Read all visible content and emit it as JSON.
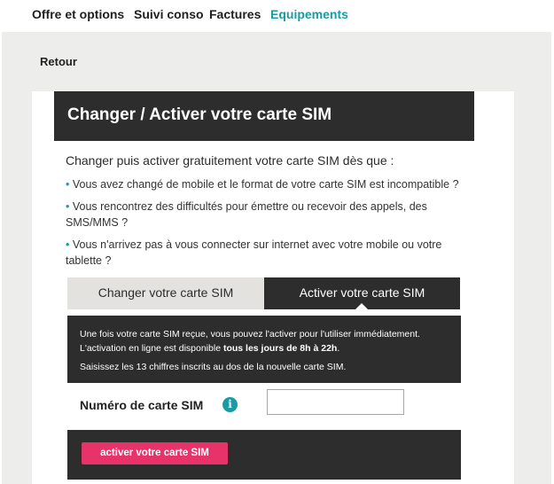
{
  "nav": {
    "items": [
      {
        "label": "Offre et options"
      },
      {
        "label": "Suivi conso"
      },
      {
        "label": "Factures"
      },
      {
        "label": "Equipements"
      }
    ]
  },
  "back_label": "Retour",
  "title": "Changer / Activer votre carte SIM",
  "intro": "Changer puis activer gratuitement votre carte SIM dès que :",
  "bullets": [
    {
      "bullet": "•",
      "text": "Vous avez changé de mobile et le format de votre carte SIM est incompatible ?"
    },
    {
      "bullet": "•",
      "text": "Vous rencontrez des difficultés pour émettre ou recevoir des appels, des SMS/MMS ?"
    },
    {
      "bullet": "•",
      "text": "Vous n'arrivez pas à vous connecter sur internet avec votre mobile ou votre tablette ?"
    }
  ],
  "tabs": [
    {
      "label": "Changer votre carte SIM"
    },
    {
      "label": "Activer votre carte SIM"
    }
  ],
  "info": {
    "line1": "Une fois votre carte SIM reçue, vous pouvez l'activer pour l'utiliser immédiatement.",
    "line2_prefix": "L'activation en ligne est disponible ",
    "line2_bold": "tous les jours de 8h à 22h",
    "line2_suffix": ".",
    "line3": "Saisissez les 13 chiffres inscrits au dos de la nouvelle carte SIM."
  },
  "sim_label": "Numéro de carte SIM",
  "info_icon": "i",
  "sim_input_value": "",
  "activate_button": "activer votre carte SIM",
  "colors": {
    "accent": "#1a9ba4",
    "dark": "#2d2d2d",
    "button": "#e8336a",
    "background": "#ededeb"
  }
}
